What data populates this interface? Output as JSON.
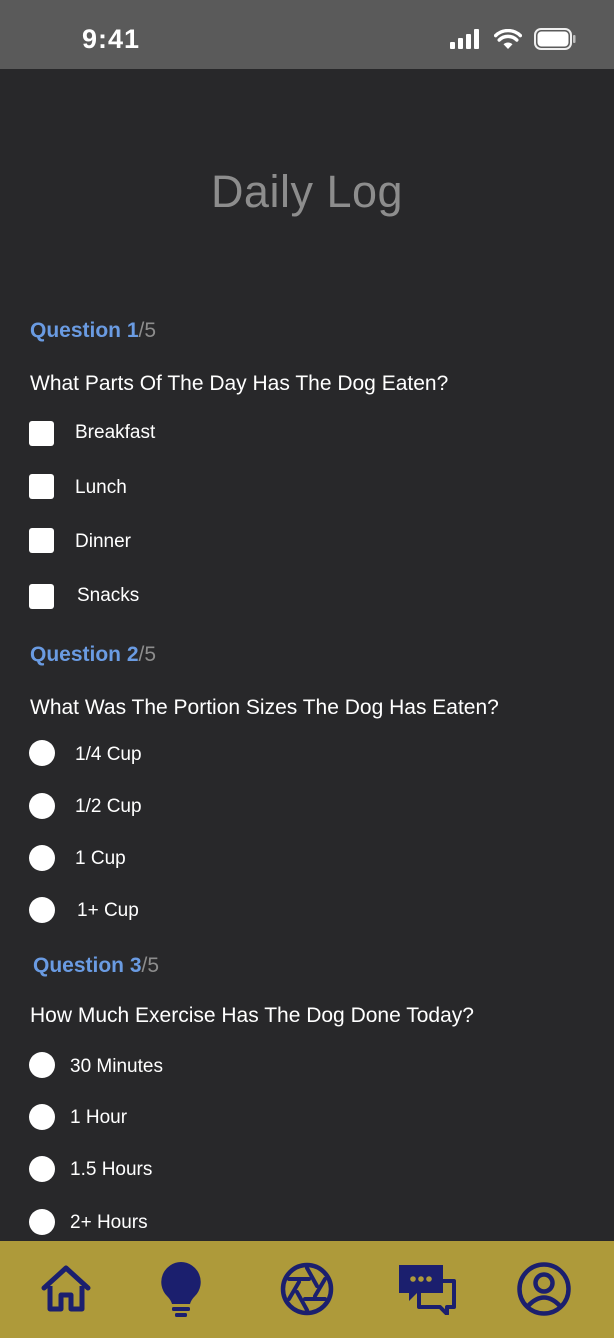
{
  "status": {
    "time": "9:41"
  },
  "page": {
    "title": "Daily Log"
  },
  "questions": [
    {
      "label": "Question 1",
      "total": "/5",
      "text": "What Parts Of The Day Has The Dog Eaten?",
      "type": "checkbox",
      "options": [
        "Breakfast",
        "Lunch",
        "Dinner",
        "Snacks"
      ]
    },
    {
      "label": "Question 2",
      "total": "/5",
      "text": "What Was The Portion Sizes The Dog Has Eaten?",
      "type": "radio",
      "options": [
        "1/4 Cup",
        "1/2 Cup",
        "1 Cup",
        "1+ Cup"
      ]
    },
    {
      "label": "Question 3",
      "total": "/5",
      "text": "How Much Exercise Has The Dog Done Today?",
      "type": "radio",
      "options": [
        "30 Minutes",
        "1 Hour",
        "1.5 Hours",
        "2+ Hours"
      ]
    }
  ],
  "nav": {
    "items": [
      "home-icon",
      "lightbulb-icon",
      "camera-shutter-icon",
      "chat-icon",
      "profile-icon"
    ]
  },
  "colors": {
    "background": "#28282a",
    "accent_blue": "#6a9be2",
    "nav_background": "#ae9a3a",
    "nav_icon": "#1b1f6e"
  }
}
